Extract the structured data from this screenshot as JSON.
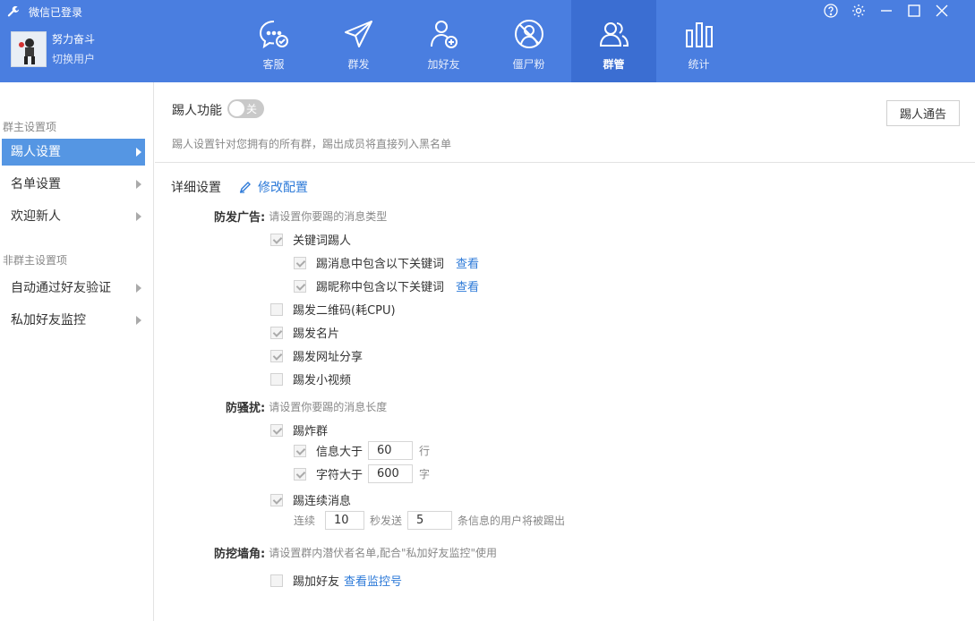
{
  "app": {
    "title": "微信已登录"
  },
  "user": {
    "name": "努力奋斗",
    "switch_label": "切换用户"
  },
  "nav": [
    {
      "label": "客服",
      "icon": "chat-icon",
      "active": false
    },
    {
      "label": "群发",
      "icon": "send-icon",
      "active": false
    },
    {
      "label": "加好友",
      "icon": "add-friend-icon",
      "active": false
    },
    {
      "label": "僵尸粉",
      "icon": "zombie-fans-icon",
      "active": false
    },
    {
      "label": "群管",
      "icon": "group-manage-icon",
      "active": true
    },
    {
      "label": "统计",
      "icon": "stats-icon",
      "active": false
    }
  ],
  "window_controls": [
    "help-icon",
    "settings-icon",
    "minimize-icon",
    "maximize-icon",
    "close-icon"
  ],
  "sidebar": {
    "owner_section": "群主设置项",
    "owner_items": [
      {
        "label": "踢人设置",
        "active": true
      },
      {
        "label": "名单设置",
        "active": false
      },
      {
        "label": "欢迎新人",
        "active": false
      }
    ],
    "nonowner_section": "非群主设置项",
    "nonowner_items": [
      {
        "label": "自动通过好友验证",
        "active": false
      },
      {
        "label": "私加好友监控",
        "active": false
      }
    ]
  },
  "kick": {
    "func_label": "踢人功能",
    "toggle_text": "关",
    "toggle_on": false,
    "desc": "踢人设置针对您拥有的所有群，踢出成员将直接列入黑名单",
    "notice_button": "踢人通告"
  },
  "detail": {
    "label": "详细设置",
    "edit_label": "修改配置"
  },
  "ads": {
    "label": "防发广告:",
    "hint": "请设置你要踢的消息类型",
    "keyword": {
      "label": "关键词踢人",
      "checked": true
    },
    "msg_keyword": {
      "label": "踢消息中包含以下关键词",
      "checked": true,
      "link": "查看"
    },
    "nick_keyword": {
      "label": "踢昵称中包含以下关键词",
      "checked": true,
      "link": "查看"
    },
    "qrcode": {
      "label": "踢发二维码(耗CPU)",
      "checked": false
    },
    "card": {
      "label": "踢发名片",
      "checked": true
    },
    "url": {
      "label": "踢发网址分享",
      "checked": true
    },
    "video": {
      "label": "踢发小视频",
      "checked": false
    }
  },
  "spam": {
    "label": "防骚扰:",
    "hint": "请设置你要踢的消息长度",
    "flood": {
      "label": "踢炸群",
      "checked": true
    },
    "msg_count": {
      "label": "信息大于",
      "checked": true,
      "value": "60",
      "unit": "行"
    },
    "char_count": {
      "label": "字符大于",
      "checked": true,
      "value": "600",
      "unit": "字"
    },
    "consecutive": {
      "label": "踢连续消息",
      "checked": true
    },
    "consecutive_prefix": "连续",
    "seconds_value": "10",
    "seconds_label": "秒发送",
    "count_value": "5",
    "count_suffix": "条信息的用户将被踢出"
  },
  "poach": {
    "label": "防挖墙角:",
    "hint": "请设置群内潜伏者名单,配合\"私加好友监控\"使用",
    "add_friend": {
      "label": "踢加好友",
      "checked": false,
      "link": "查看监控号"
    }
  }
}
